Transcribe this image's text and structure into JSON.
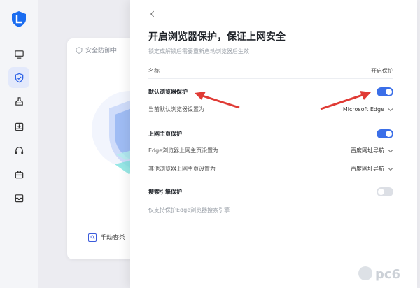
{
  "sidebar": {
    "items": [
      {
        "icon": "monitor-icon"
      },
      {
        "icon": "shield-check-icon",
        "active": true
      },
      {
        "icon": "broom-icon"
      },
      {
        "icon": "download-box-icon"
      },
      {
        "icon": "headset-icon"
      },
      {
        "icon": "toolbox-icon"
      },
      {
        "icon": "mailbox-icon"
      }
    ]
  },
  "background_card": {
    "title": "安全防御中",
    "manual_button": "手动查杀"
  },
  "panel": {
    "title": "开启浏览器保护，保证上网安全",
    "subtitle": "锁定或解锁后需要重新启动浏览器后生效",
    "column_name": "名称",
    "column_toggle": "开启保护",
    "sections": {
      "default_browser": {
        "label": "默认浏览器保护",
        "enabled": true,
        "setting_label": "当前默认浏览器设置为",
        "setting_value": "Microsoft Edge"
      },
      "homepage": {
        "label": "上网主页保护",
        "enabled": true,
        "edge_label": "Edge浏览器上网主页设置为",
        "edge_value": "百度网址导航",
        "other_label": "其他浏览器上网主页设置为",
        "other_value": "百度网址导航"
      },
      "search_engine": {
        "label": "搜索引擎保护",
        "enabled": false,
        "note": "仅支持保护Edge浏览器搜索引擎"
      }
    }
  },
  "colors": {
    "accent": "#3b6fe8",
    "arrow": "#e03b35"
  },
  "watermark": "pc6"
}
